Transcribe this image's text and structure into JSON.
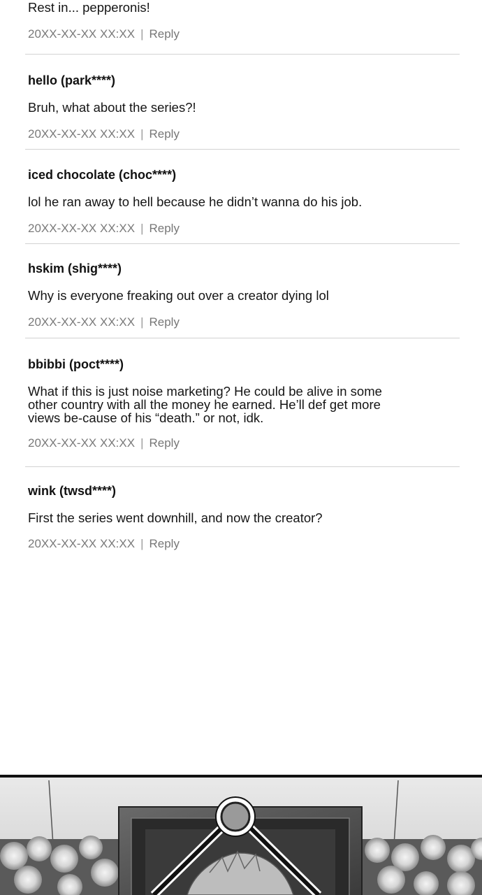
{
  "comments": [
    {
      "user": "",
      "text": "Rest in... pepperonis!",
      "timestamp": "20XX-XX-XX XX:XX",
      "reply": "Reply"
    },
    {
      "user": "hello (park****)",
      "text": "Bruh, what about the series?!",
      "timestamp": "20XX-XX-XX XX:XX",
      "reply": "Reply"
    },
    {
      "user": "iced chocolate (choc****)",
      "text": "lol he ran away to hell because he didn’t wanna do his job.",
      "timestamp": "20XX-XX-XX XX:XX",
      "reply": "Reply"
    },
    {
      "user": "hskim (shig****)",
      "text": "Why is everyone freaking out over a creator dying lol",
      "timestamp": "20XX-XX-XX XX:XX",
      "reply": "Reply"
    },
    {
      "user": "bbibbi (poct****)",
      "text": "What if this is just noise marketing? He could be alive in some other country with all the money he earned. He’ll def get more views be-cause of his “death.” or not, idk.",
      "timestamp": "20XX-XX-XX XX:XX",
      "reply": "Reply"
    },
    {
      "user": "wink (twsd****)",
      "text": "First the series went downhill, and now the creator?",
      "timestamp": "20XX-XX-XX XX:XX",
      "reply": "Reply"
    }
  ],
  "separator": "|",
  "colors": {
    "username": "#111111",
    "body_text": "#151515",
    "meta_text": "#7a7a7a",
    "divider": "#d2d2d2",
    "background": "#ffffff"
  },
  "icons": {
    "panel": "funeral-portrait-illustration"
  }
}
